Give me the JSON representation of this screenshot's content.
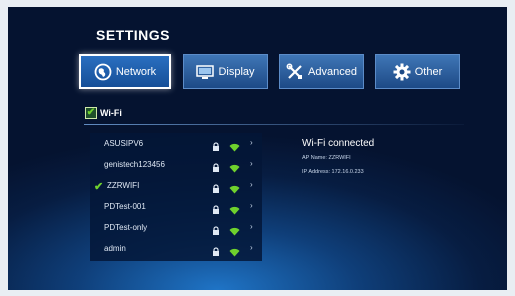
{
  "title": "SETTINGS",
  "tabs": [
    {
      "label": "Network",
      "icon": "globe-icon",
      "active": true
    },
    {
      "label": "Display",
      "icon": "display-icon",
      "active": false
    },
    {
      "label": "Advanced",
      "icon": "tools-icon",
      "active": false
    },
    {
      "label": "Other",
      "icon": "gear-icon",
      "active": false
    }
  ],
  "wifi_toggle": {
    "label": "Wi-Fi",
    "checked": true
  },
  "networks": [
    {
      "name": "ASUSIPV6",
      "connected": false
    },
    {
      "name": "genistech123456",
      "connected": false
    },
    {
      "name": "ZZRWIFI",
      "connected": true
    },
    {
      "name": "PDTest-001",
      "connected": false
    },
    {
      "name": "PDTest-only",
      "connected": false
    },
    {
      "name": "admin",
      "connected": false
    }
  ],
  "status": {
    "title": "Wi-Fi connected",
    "ap_name": "AP Name:  ZZRWIFI",
    "ip_address": "IP Address:  172.16.0.233"
  },
  "colors": {
    "accent_green": "#6fd12d",
    "tab_blue": "#2a6fc0"
  }
}
